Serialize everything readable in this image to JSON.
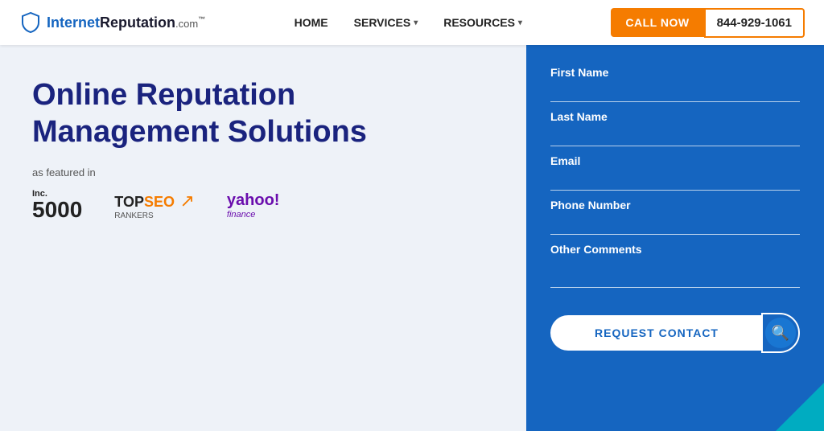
{
  "header": {
    "logo_internet": "Internet",
    "logo_reputation": "Reputation",
    "logo_com": ".com",
    "logo_tm": "™",
    "nav_items": [
      {
        "label": "HOME",
        "has_dropdown": false
      },
      {
        "label": "SERVICES",
        "has_dropdown": true
      },
      {
        "label": "RESOURCES",
        "has_dropdown": true
      }
    ],
    "call_now_label": "CALL NOW",
    "phone_number": "844-929-1061"
  },
  "hero": {
    "title_line1": "Online Reputation",
    "title_line2": "Management Solutions",
    "featured_label": "as featured in",
    "logos": {
      "inc": {
        "line1": "Inc.",
        "line2": "5000"
      },
      "topseo": {
        "top": "TOP",
        "seo": "SEO",
        "rankers": "RANKERS"
      },
      "yahoo": {
        "yahoo": "yahoo!",
        "finance": "finance"
      }
    }
  },
  "form": {
    "fields": [
      {
        "label": "First Name",
        "type": "input",
        "name": "first-name-input"
      },
      {
        "label": "Last Name",
        "type": "input",
        "name": "last-name-input"
      },
      {
        "label": "Email",
        "type": "input",
        "name": "email-input"
      },
      {
        "label": "Phone Number",
        "type": "input",
        "name": "phone-input"
      },
      {
        "label": "Other Comments",
        "type": "textarea",
        "name": "comments-textarea"
      }
    ],
    "submit_label": "REQUEST CONTACT",
    "search_icon": "🔍"
  }
}
